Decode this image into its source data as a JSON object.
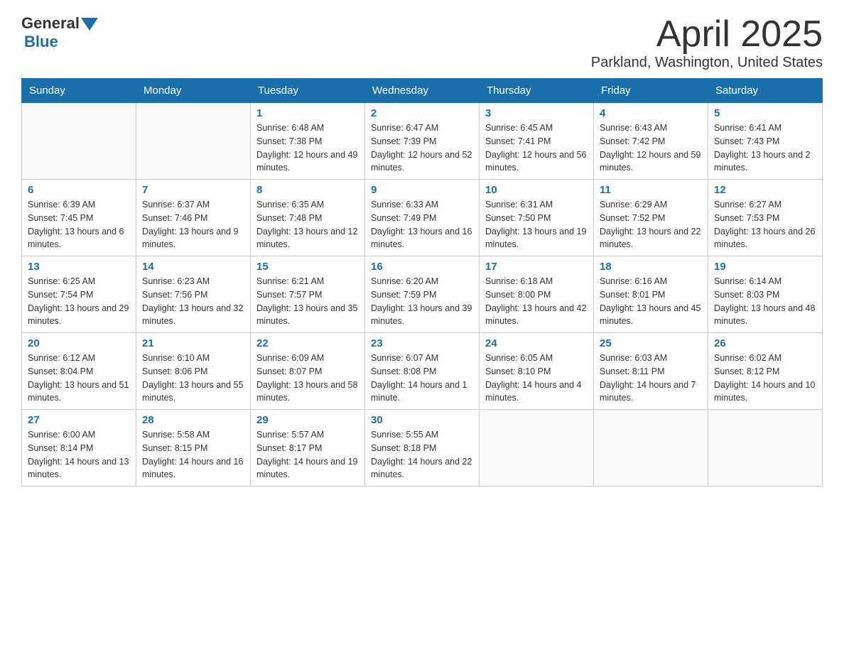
{
  "header": {
    "logo_text_general": "General",
    "logo_text_blue": "Blue",
    "month_title": "April 2025",
    "location": "Parkland, Washington, United States"
  },
  "weekdays": [
    "Sunday",
    "Monday",
    "Tuesday",
    "Wednesday",
    "Thursday",
    "Friday",
    "Saturday"
  ],
  "weeks": [
    [
      {
        "day": "",
        "sunrise": "",
        "sunset": "",
        "daylight": ""
      },
      {
        "day": "",
        "sunrise": "",
        "sunset": "",
        "daylight": ""
      },
      {
        "day": "1",
        "sunrise": "Sunrise: 6:48 AM",
        "sunset": "Sunset: 7:38 PM",
        "daylight": "Daylight: 12 hours and 49 minutes."
      },
      {
        "day": "2",
        "sunrise": "Sunrise: 6:47 AM",
        "sunset": "Sunset: 7:39 PM",
        "daylight": "Daylight: 12 hours and 52 minutes."
      },
      {
        "day": "3",
        "sunrise": "Sunrise: 6:45 AM",
        "sunset": "Sunset: 7:41 PM",
        "daylight": "Daylight: 12 hours and 56 minutes."
      },
      {
        "day": "4",
        "sunrise": "Sunrise: 6:43 AM",
        "sunset": "Sunset: 7:42 PM",
        "daylight": "Daylight: 12 hours and 59 minutes."
      },
      {
        "day": "5",
        "sunrise": "Sunrise: 6:41 AM",
        "sunset": "Sunset: 7:43 PM",
        "daylight": "Daylight: 13 hours and 2 minutes."
      }
    ],
    [
      {
        "day": "6",
        "sunrise": "Sunrise: 6:39 AM",
        "sunset": "Sunset: 7:45 PM",
        "daylight": "Daylight: 13 hours and 6 minutes."
      },
      {
        "day": "7",
        "sunrise": "Sunrise: 6:37 AM",
        "sunset": "Sunset: 7:46 PM",
        "daylight": "Daylight: 13 hours and 9 minutes."
      },
      {
        "day": "8",
        "sunrise": "Sunrise: 6:35 AM",
        "sunset": "Sunset: 7:48 PM",
        "daylight": "Daylight: 13 hours and 12 minutes."
      },
      {
        "day": "9",
        "sunrise": "Sunrise: 6:33 AM",
        "sunset": "Sunset: 7:49 PM",
        "daylight": "Daylight: 13 hours and 16 minutes."
      },
      {
        "day": "10",
        "sunrise": "Sunrise: 6:31 AM",
        "sunset": "Sunset: 7:50 PM",
        "daylight": "Daylight: 13 hours and 19 minutes."
      },
      {
        "day": "11",
        "sunrise": "Sunrise: 6:29 AM",
        "sunset": "Sunset: 7:52 PM",
        "daylight": "Daylight: 13 hours and 22 minutes."
      },
      {
        "day": "12",
        "sunrise": "Sunrise: 6:27 AM",
        "sunset": "Sunset: 7:53 PM",
        "daylight": "Daylight: 13 hours and 26 minutes."
      }
    ],
    [
      {
        "day": "13",
        "sunrise": "Sunrise: 6:25 AM",
        "sunset": "Sunset: 7:54 PM",
        "daylight": "Daylight: 13 hours and 29 minutes."
      },
      {
        "day": "14",
        "sunrise": "Sunrise: 6:23 AM",
        "sunset": "Sunset: 7:56 PM",
        "daylight": "Daylight: 13 hours and 32 minutes."
      },
      {
        "day": "15",
        "sunrise": "Sunrise: 6:21 AM",
        "sunset": "Sunset: 7:57 PM",
        "daylight": "Daylight: 13 hours and 35 minutes."
      },
      {
        "day": "16",
        "sunrise": "Sunrise: 6:20 AM",
        "sunset": "Sunset: 7:59 PM",
        "daylight": "Daylight: 13 hours and 39 minutes."
      },
      {
        "day": "17",
        "sunrise": "Sunrise: 6:18 AM",
        "sunset": "Sunset: 8:00 PM",
        "daylight": "Daylight: 13 hours and 42 minutes."
      },
      {
        "day": "18",
        "sunrise": "Sunrise: 6:16 AM",
        "sunset": "Sunset: 8:01 PM",
        "daylight": "Daylight: 13 hours and 45 minutes."
      },
      {
        "day": "19",
        "sunrise": "Sunrise: 6:14 AM",
        "sunset": "Sunset: 8:03 PM",
        "daylight": "Daylight: 13 hours and 48 minutes."
      }
    ],
    [
      {
        "day": "20",
        "sunrise": "Sunrise: 6:12 AM",
        "sunset": "Sunset: 8:04 PM",
        "daylight": "Daylight: 13 hours and 51 minutes."
      },
      {
        "day": "21",
        "sunrise": "Sunrise: 6:10 AM",
        "sunset": "Sunset: 8:06 PM",
        "daylight": "Daylight: 13 hours and 55 minutes."
      },
      {
        "day": "22",
        "sunrise": "Sunrise: 6:09 AM",
        "sunset": "Sunset: 8:07 PM",
        "daylight": "Daylight: 13 hours and 58 minutes."
      },
      {
        "day": "23",
        "sunrise": "Sunrise: 6:07 AM",
        "sunset": "Sunset: 8:08 PM",
        "daylight": "Daylight: 14 hours and 1 minute."
      },
      {
        "day": "24",
        "sunrise": "Sunrise: 6:05 AM",
        "sunset": "Sunset: 8:10 PM",
        "daylight": "Daylight: 14 hours and 4 minutes."
      },
      {
        "day": "25",
        "sunrise": "Sunrise: 6:03 AM",
        "sunset": "Sunset: 8:11 PM",
        "daylight": "Daylight: 14 hours and 7 minutes."
      },
      {
        "day": "26",
        "sunrise": "Sunrise: 6:02 AM",
        "sunset": "Sunset: 8:12 PM",
        "daylight": "Daylight: 14 hours and 10 minutes."
      }
    ],
    [
      {
        "day": "27",
        "sunrise": "Sunrise: 6:00 AM",
        "sunset": "Sunset: 8:14 PM",
        "daylight": "Daylight: 14 hours and 13 minutes."
      },
      {
        "day": "28",
        "sunrise": "Sunrise: 5:58 AM",
        "sunset": "Sunset: 8:15 PM",
        "daylight": "Daylight: 14 hours and 16 minutes."
      },
      {
        "day": "29",
        "sunrise": "Sunrise: 5:57 AM",
        "sunset": "Sunset: 8:17 PM",
        "daylight": "Daylight: 14 hours and 19 minutes."
      },
      {
        "day": "30",
        "sunrise": "Sunrise: 5:55 AM",
        "sunset": "Sunset: 8:18 PM",
        "daylight": "Daylight: 14 hours and 22 minutes."
      },
      {
        "day": "",
        "sunrise": "",
        "sunset": "",
        "daylight": ""
      },
      {
        "day": "",
        "sunrise": "",
        "sunset": "",
        "daylight": ""
      },
      {
        "day": "",
        "sunrise": "",
        "sunset": "",
        "daylight": ""
      }
    ]
  ]
}
